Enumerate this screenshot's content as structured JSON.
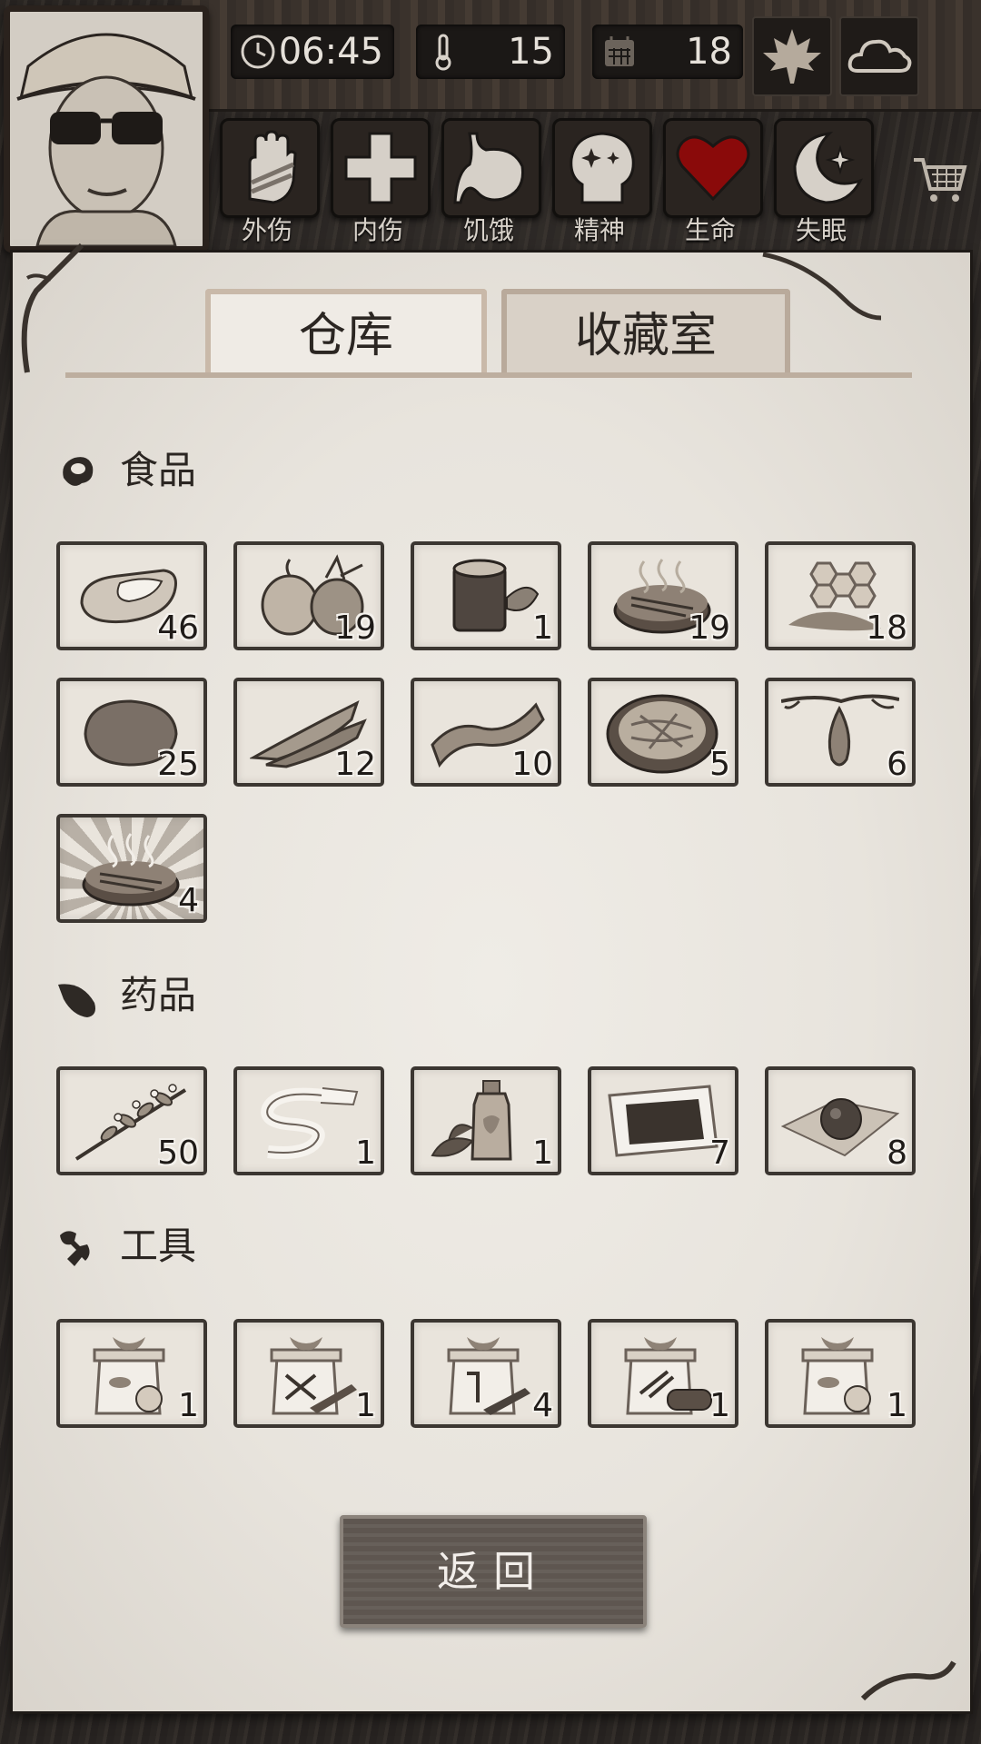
{
  "top_stats": {
    "time": "06:45",
    "temperature": "15",
    "day": "18",
    "season_icon": "maple-leaf-icon",
    "weather_icon": "cloud-icon"
  },
  "status_bars": [
    {
      "label": "外伤",
      "icon": "hand-bandage-icon",
      "level": 0
    },
    {
      "label": "内伤",
      "icon": "cross-icon",
      "level": 0
    },
    {
      "label": "饥饿",
      "icon": "stomach-icon",
      "level": 0
    },
    {
      "label": "精神",
      "icon": "head-sparkle-icon",
      "level": 0
    },
    {
      "label": "生命",
      "icon": "heart-icon",
      "level": 1.0
    },
    {
      "label": "失眠",
      "icon": "moon-star-icon",
      "level": 0
    }
  ],
  "tabs": {
    "warehouse": "仓库",
    "collection": "收藏室"
  },
  "sections": {
    "food": {
      "title": "食品",
      "items": [
        {
          "icon": "raw-meat-icon",
          "count": "46"
        },
        {
          "icon": "onion-icon",
          "count": "19"
        },
        {
          "icon": "tea-cup-icon",
          "count": "1"
        },
        {
          "icon": "grilled-meat-icon",
          "count": "19"
        },
        {
          "icon": "honeycomb-icon",
          "count": "18"
        },
        {
          "icon": "potato-icon",
          "count": "25"
        },
        {
          "icon": "dried-fish-icon",
          "count": "12"
        },
        {
          "icon": "bacon-icon",
          "count": "10"
        },
        {
          "icon": "noodle-bowl-icon",
          "count": "5"
        },
        {
          "icon": "fruit-pod-icon",
          "count": "6"
        },
        {
          "icon": "special-steak-icon",
          "count": "4"
        }
      ]
    },
    "medicine": {
      "title": "药品",
      "items": [
        {
          "icon": "herb-branch-icon",
          "count": "50"
        },
        {
          "icon": "bandage-roll-icon",
          "count": "1"
        },
        {
          "icon": "herbal-bottle-icon",
          "count": "1"
        },
        {
          "icon": "plaster-icon",
          "count": "7"
        },
        {
          "icon": "pill-icon",
          "count": "8"
        }
      ]
    },
    "tools": {
      "title": "工具",
      "items": [
        {
          "icon": "food-crate-icon",
          "count": "1"
        },
        {
          "icon": "tool-crate-icon",
          "count": "1"
        },
        {
          "icon": "axe-crate-icon",
          "count": "4"
        },
        {
          "icon": "wood-crate-icon",
          "count": "1"
        },
        {
          "icon": "food-crate-icon",
          "count": "1"
        }
      ]
    }
  },
  "back_button": "返回"
}
